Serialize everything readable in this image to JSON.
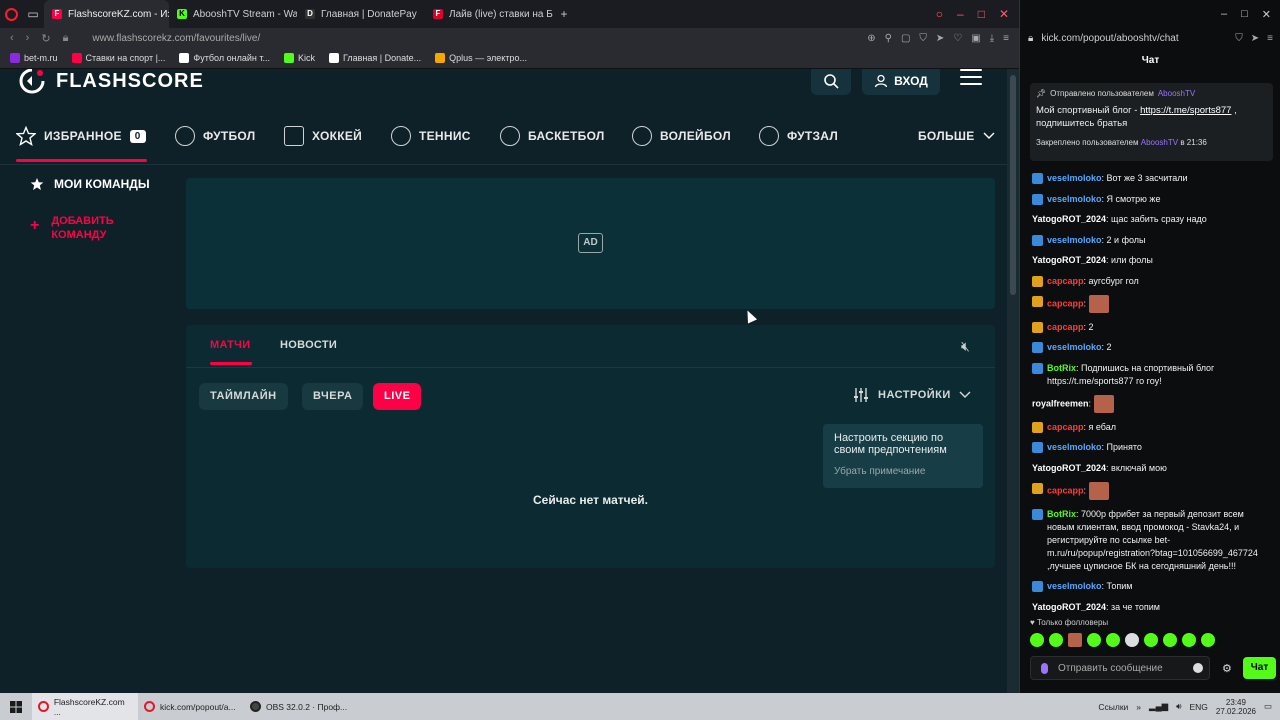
{
  "browser": {
    "tabs": [
      {
        "title": "FlashscoreKZ.com - Избр",
        "color": "#ff0046",
        "letter": "F",
        "active": true
      },
      {
        "title": "AbooshTV Stream - Watc",
        "color": "#53fc18",
        "letter": "K",
        "active": false
      },
      {
        "title": "Главная | DonatePay",
        "color": "#ffffff",
        "letter": "D",
        "active": false
      },
      {
        "title": "Лайв (live) ставки на Баск",
        "color": "#e0002a",
        "letter": "F",
        "active": false
      }
    ],
    "url": "www.flashscorekz.com/favourites/live/",
    "bookmarks": [
      {
        "label": "bet-m.ru",
        "color": "#8a2be2"
      },
      {
        "label": "Ставки на спорт |...",
        "color": "#ff0046"
      },
      {
        "label": "Футбол онлайн т...",
        "color": "#ffffff"
      },
      {
        "label": "Kick",
        "color": "#53fc18"
      },
      {
        "label": "Главная | Donate...",
        "color": "#ffffff"
      },
      {
        "label": "Qplus — электро...",
        "color": "#f7a600"
      }
    ]
  },
  "flashscore": {
    "logo_text": "FLASHSCORE",
    "login_label": "ВХОД",
    "nav": [
      {
        "label": "ИЗБРАННОЕ",
        "icon": "star-icon"
      },
      {
        "label": "ФУТБОЛ",
        "icon": "football-icon"
      },
      {
        "label": "ХОККЕЙ",
        "icon": "hockey-icon"
      },
      {
        "label": "ТЕННИС",
        "icon": "tennis-icon"
      },
      {
        "label": "БАСКЕТБОЛ",
        "icon": "basketball-icon"
      },
      {
        "label": "ВОЛЕЙБОЛ",
        "icon": "volleyball-icon"
      },
      {
        "label": "ФУТЗАЛ",
        "icon": "futsal-icon"
      }
    ],
    "favourites_count": "0",
    "more_label": "БОЛЬШЕ",
    "sidebar": {
      "my_teams": "МОИ КОМАНДЫ",
      "add_team_line1": "ДОБАВИТЬ",
      "add_team_line2": "КОМАНДУ"
    },
    "ad_label": "AD",
    "tabs": {
      "matches": "МАТЧИ",
      "news": "НОВОСТИ"
    },
    "filters": {
      "timeline": "ТАЙМЛАЙН",
      "yesterday": "ВЧЕРА",
      "live": "LIVE"
    },
    "settings_label": "НАСТРОЙКИ",
    "tooltip": {
      "text": "Настроить секцию по своим предпочтениям",
      "dismiss": "Убрать примечание"
    },
    "empty_text": "Сейчас нет матчей."
  },
  "chat": {
    "url": "kick.com/popout/abooshtv/chat",
    "title": "Чат",
    "pinned": {
      "header_prefix": "Отправлено пользователем",
      "header_user": "AbooshTV",
      "body_text": "Мой спортивный блог - ",
      "body_link": "https://t.me/sports877",
      "body_suffix": " , подпишитесь братья",
      "footer_prefix": "Закреплено пользователем",
      "footer_user": "AbooshTV",
      "footer_time": "в 21:36"
    },
    "messages": [
      {
        "badge": "blue",
        "user": "veselmoloko",
        "ucolor": "u-blue",
        "text": "Вот же 3 засчитали"
      },
      {
        "badge": "blue",
        "user": "veselmoloko",
        "ucolor": "u-blue",
        "text": "Я смотрю же"
      },
      {
        "badge": "",
        "user": "YatogoROT_2024",
        "ucolor": "u-white",
        "text": "щас забить сразу надо"
      },
      {
        "badge": "blue",
        "user": "veselmoloko",
        "ucolor": "u-blue",
        "text": "2 и фолы"
      },
      {
        "badge": "",
        "user": "YatogoROT_2024",
        "ucolor": "u-white",
        "text": "или фолы"
      },
      {
        "badge": "gold",
        "user": "capcapp",
        "ucolor": "u-red",
        "text": "аугсбург гол"
      },
      {
        "badge": "gold",
        "user": "capcapp",
        "ucolor": "u-red",
        "text": "",
        "emote": true
      },
      {
        "badge": "gold",
        "user": "capcapp",
        "ucolor": "u-red",
        "text": "2"
      },
      {
        "badge": "blue",
        "user": "veselmoloko",
        "ucolor": "u-blue",
        "text": "2"
      },
      {
        "badge": "blue",
        "user": "BotRix",
        "ucolor": "u-green",
        "text": "Подпишись на спортивный блог https://t.me/sports877 го гоу!"
      },
      {
        "badge": "",
        "user": "royalfreemen",
        "ucolor": "u-white",
        "text": "",
        "emote": true
      },
      {
        "badge": "gold",
        "user": "capcapp",
        "ucolor": "u-red",
        "text": "я ебал"
      },
      {
        "badge": "blue",
        "user": "veselmoloko",
        "ucolor": "u-blue",
        "text": "Принято"
      },
      {
        "badge": "",
        "user": "YatogoROT_2024",
        "ucolor": "u-white",
        "text": "включай мою"
      },
      {
        "badge": "gold",
        "user": "capcapp",
        "ucolor": "u-red",
        "text": "",
        "emote": true
      },
      {
        "badge": "blue",
        "user": "BotRix",
        "ucolor": "u-green",
        "text": "7000р фрибет за первый депозит всем новым клиентам, ввод промокод - Stavka24, и регистрируйте по ссылке bet-m.ru/ru/popup/registration?btag=101056699_467724 ,лучшее цуписное БК на сегодняшний день!!!"
      },
      {
        "badge": "blue",
        "user": "veselmoloko",
        "ucolor": "u-blue",
        "text": "Топим"
      },
      {
        "badge": "",
        "user": "YatogoROT_2024",
        "ucolor": "u-white",
        "text": "за че топим"
      }
    ],
    "followers_only": "Только фолловеры",
    "input_placeholder": "Отправить сообщение",
    "send_label": "Чат"
  },
  "taskbar": {
    "items": [
      {
        "label": "FlashscoreKZ.com ...",
        "active": true
      },
      {
        "label": "kick.com/popout/a...",
        "active": false
      },
      {
        "label": "OBS 32.0.2 · Проф...",
        "active": false
      }
    ],
    "tray_label": "Ссылки",
    "lang": "ENG",
    "time": "23:49",
    "date": "27.02.2026"
  }
}
